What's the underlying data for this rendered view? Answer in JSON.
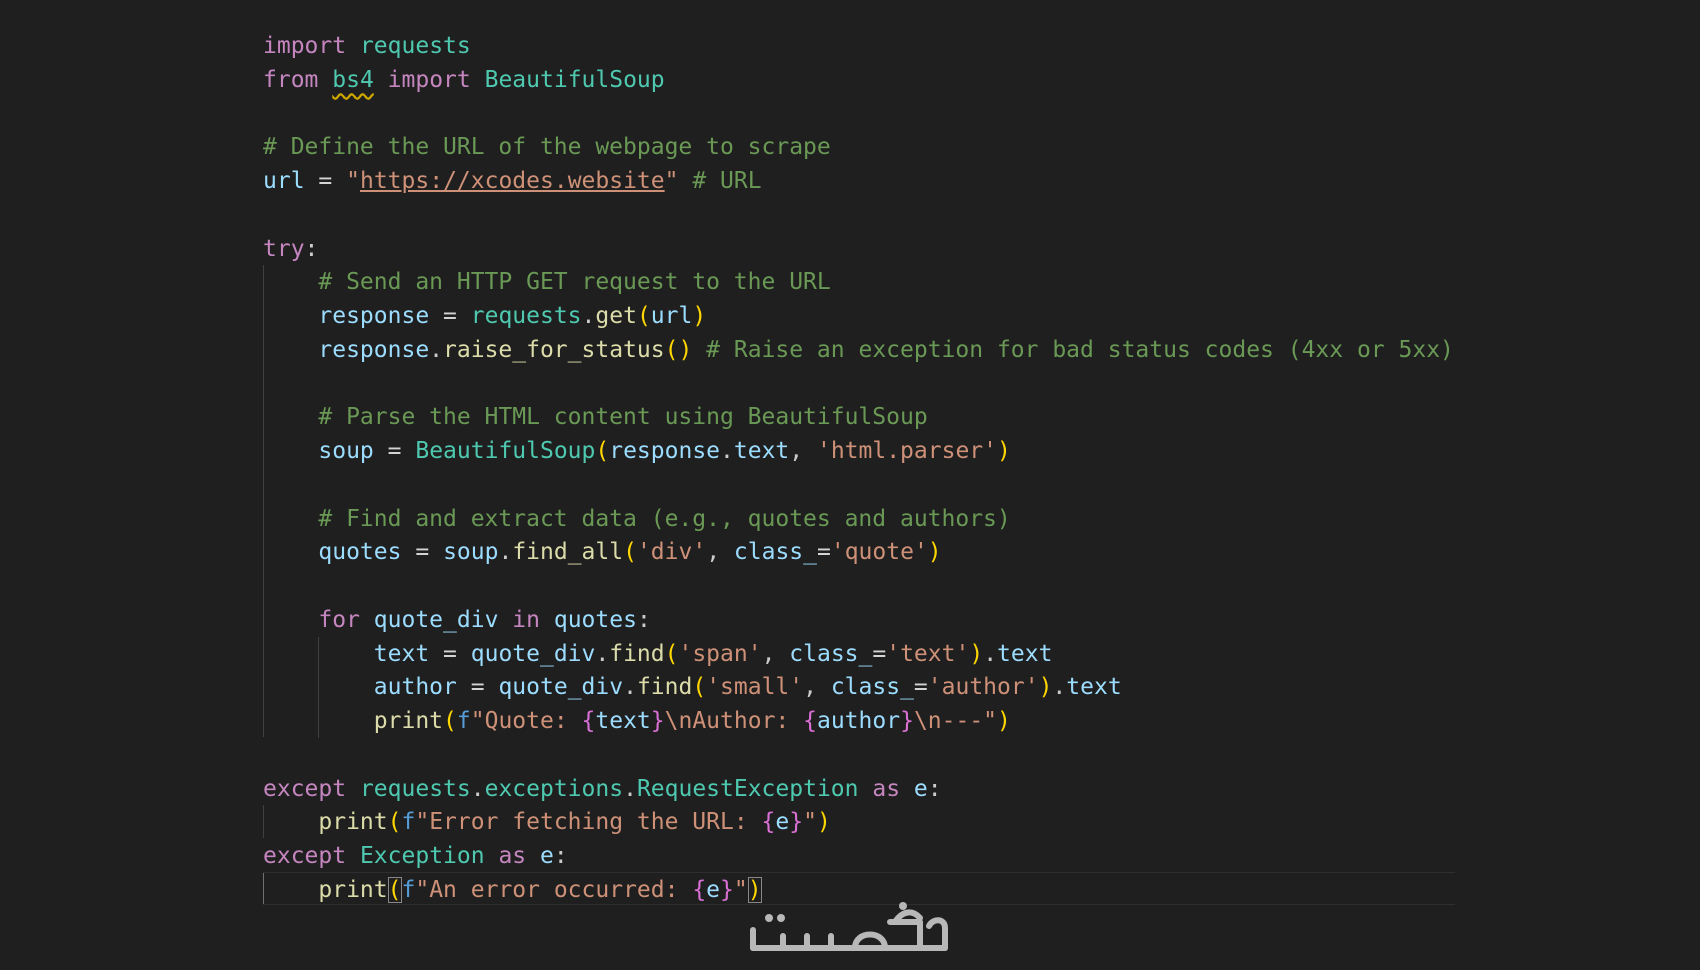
{
  "editor": {
    "lines": [
      [
        [
          "import",
          "kw"
        ],
        [
          " ",
          "pn"
        ],
        [
          "requests",
          "cls"
        ]
      ],
      [
        [
          "from",
          "kw"
        ],
        [
          " ",
          "pn"
        ],
        [
          "bs4",
          "cls squiggle"
        ],
        [
          " ",
          "pn"
        ],
        [
          "import",
          "kw"
        ],
        [
          " ",
          "pn"
        ],
        [
          "BeautifulSoup",
          "cls"
        ]
      ],
      [],
      [
        [
          "# Define the URL of the webpage to scrape",
          "cmt"
        ]
      ],
      [
        [
          "url",
          "var"
        ],
        [
          " ",
          "pn"
        ],
        [
          "=",
          "op"
        ],
        [
          " ",
          "pn"
        ],
        [
          "\"",
          "str"
        ],
        [
          "https://xcodes.website",
          "str link"
        ],
        [
          "\"",
          "str"
        ],
        [
          " ",
          "pn"
        ],
        [
          "# URL",
          "cmt"
        ]
      ],
      [],
      [
        [
          "try",
          "kw"
        ],
        [
          ":",
          "pn"
        ]
      ],
      [
        [
          "    ",
          "pn"
        ],
        [
          "# Send an HTTP GET request to the URL",
          "cmt"
        ]
      ],
      [
        [
          "    ",
          "pn"
        ],
        [
          "response",
          "var"
        ],
        [
          " ",
          "pn"
        ],
        [
          "=",
          "op"
        ],
        [
          " ",
          "pn"
        ],
        [
          "requests",
          "cls"
        ],
        [
          ".",
          "pn"
        ],
        [
          "get",
          "fn"
        ],
        [
          "(",
          "b1"
        ],
        [
          "url",
          "var"
        ],
        [
          ")",
          "b1"
        ]
      ],
      [
        [
          "    ",
          "pn"
        ],
        [
          "response",
          "var"
        ],
        [
          ".",
          "pn"
        ],
        [
          "raise_for_status",
          "fn"
        ],
        [
          "()",
          "b1"
        ],
        [
          " ",
          "pn"
        ],
        [
          "# Raise an exception for bad status codes (4xx or 5xx)",
          "cmt"
        ]
      ],
      [],
      [
        [
          "    ",
          "pn"
        ],
        [
          "# Parse the HTML content using BeautifulSoup",
          "cmt"
        ]
      ],
      [
        [
          "    ",
          "pn"
        ],
        [
          "soup",
          "var"
        ],
        [
          " ",
          "pn"
        ],
        [
          "=",
          "op"
        ],
        [
          " ",
          "pn"
        ],
        [
          "BeautifulSoup",
          "cls"
        ],
        [
          "(",
          "b1"
        ],
        [
          "response",
          "var"
        ],
        [
          ".",
          "pn"
        ],
        [
          "text",
          "var"
        ],
        [
          ", ",
          "pn"
        ],
        [
          "'html.parser'",
          "str"
        ],
        [
          ")",
          "b1"
        ]
      ],
      [],
      [
        [
          "    ",
          "pn"
        ],
        [
          "# Find and extract data (e.g., quotes and authors)",
          "cmt"
        ]
      ],
      [
        [
          "    ",
          "pn"
        ],
        [
          "quotes",
          "var"
        ],
        [
          " ",
          "pn"
        ],
        [
          "=",
          "op"
        ],
        [
          " ",
          "pn"
        ],
        [
          "soup",
          "var"
        ],
        [
          ".",
          "pn"
        ],
        [
          "find_all",
          "fn"
        ],
        [
          "(",
          "b1"
        ],
        [
          "'div'",
          "str"
        ],
        [
          ", ",
          "pn"
        ],
        [
          "class_",
          "var"
        ],
        [
          "=",
          "op"
        ],
        [
          "'quote'",
          "str"
        ],
        [
          ")",
          "b1"
        ]
      ],
      [],
      [
        [
          "    ",
          "pn"
        ],
        [
          "for",
          "kw"
        ],
        [
          " ",
          "pn"
        ],
        [
          "quote_div",
          "var"
        ],
        [
          " ",
          "pn"
        ],
        [
          "in",
          "kw"
        ],
        [
          " ",
          "pn"
        ],
        [
          "quotes",
          "var"
        ],
        [
          ":",
          "pn"
        ]
      ],
      [
        [
          "        ",
          "pn"
        ],
        [
          "text",
          "var"
        ],
        [
          " ",
          "pn"
        ],
        [
          "=",
          "op"
        ],
        [
          " ",
          "pn"
        ],
        [
          "quote_div",
          "var"
        ],
        [
          ".",
          "pn"
        ],
        [
          "find",
          "fn"
        ],
        [
          "(",
          "b1"
        ],
        [
          "'span'",
          "str"
        ],
        [
          ", ",
          "pn"
        ],
        [
          "class_",
          "var"
        ],
        [
          "=",
          "op"
        ],
        [
          "'text'",
          "str"
        ],
        [
          ")",
          "b1"
        ],
        [
          ".",
          "pn"
        ],
        [
          "text",
          "var"
        ]
      ],
      [
        [
          "        ",
          "pn"
        ],
        [
          "author",
          "var"
        ],
        [
          " ",
          "pn"
        ],
        [
          "=",
          "op"
        ],
        [
          " ",
          "pn"
        ],
        [
          "quote_div",
          "var"
        ],
        [
          ".",
          "pn"
        ],
        [
          "find",
          "fn"
        ],
        [
          "(",
          "b1"
        ],
        [
          "'small'",
          "str"
        ],
        [
          ", ",
          "pn"
        ],
        [
          "class_",
          "var"
        ],
        [
          "=",
          "op"
        ],
        [
          "'author'",
          "str"
        ],
        [
          ")",
          "b1"
        ],
        [
          ".",
          "pn"
        ],
        [
          "text",
          "var"
        ]
      ],
      [
        [
          "        ",
          "pn"
        ],
        [
          "print",
          "fn"
        ],
        [
          "(",
          "b1"
        ],
        [
          "f",
          "fpre"
        ],
        [
          "\"Quote: ",
          "str"
        ],
        [
          "{",
          "b2"
        ],
        [
          "text",
          "var"
        ],
        [
          "}",
          "b2"
        ],
        [
          "\\nAuthor: ",
          "str"
        ],
        [
          "{",
          "b2"
        ],
        [
          "author",
          "var"
        ],
        [
          "}",
          "b2"
        ],
        [
          "\\n---\"",
          "str"
        ],
        [
          ")",
          "b1"
        ]
      ],
      [],
      [
        [
          "except",
          "kw"
        ],
        [
          " ",
          "pn"
        ],
        [
          "requests",
          "cls"
        ],
        [
          ".",
          "pn"
        ],
        [
          "exceptions",
          "cls"
        ],
        [
          ".",
          "pn"
        ],
        [
          "RequestException",
          "cls"
        ],
        [
          " ",
          "pn"
        ],
        [
          "as",
          "kw"
        ],
        [
          " ",
          "pn"
        ],
        [
          "e",
          "var"
        ],
        [
          ":",
          "pn"
        ]
      ],
      [
        [
          "    ",
          "pn"
        ],
        [
          "print",
          "fn"
        ],
        [
          "(",
          "b1"
        ],
        [
          "f",
          "fpre"
        ],
        [
          "\"Error fetching the URL: ",
          "str"
        ],
        [
          "{",
          "b2"
        ],
        [
          "e",
          "var"
        ],
        [
          "}",
          "b2"
        ],
        [
          "\"",
          "str"
        ],
        [
          ")",
          "b1"
        ]
      ],
      [
        [
          "except",
          "kw"
        ],
        [
          " ",
          "pn"
        ],
        [
          "Exception",
          "cls"
        ],
        [
          " ",
          "pn"
        ],
        [
          "as",
          "kw"
        ],
        [
          " ",
          "pn"
        ],
        [
          "e",
          "var"
        ],
        [
          ":",
          "pn"
        ]
      ],
      [
        [
          "    ",
          "pn"
        ],
        [
          "print",
          "fn"
        ],
        [
          "(",
          "b1 bracket-match"
        ],
        [
          "f",
          "fpre"
        ],
        [
          "\"An error occurred: ",
          "str"
        ],
        [
          "{",
          "b2"
        ],
        [
          "e",
          "var"
        ],
        [
          "}",
          "b2"
        ],
        [
          "\"",
          "str"
        ],
        [
          ")",
          "b1 bracket-match"
        ]
      ]
    ],
    "colors": {
      "background": "#1f1f1f",
      "keyword": "#c586c0",
      "class": "#4ec9b0",
      "variable": "#9cdcfe",
      "function": "#dcdcaa",
      "string": "#ce9178",
      "comment": "#6a9955",
      "bracket_1": "#ffd700",
      "bracket_2": "#da70d6"
    }
  },
  "watermark": {
    "text": "خمسات",
    "color": "#b8b8b8"
  }
}
